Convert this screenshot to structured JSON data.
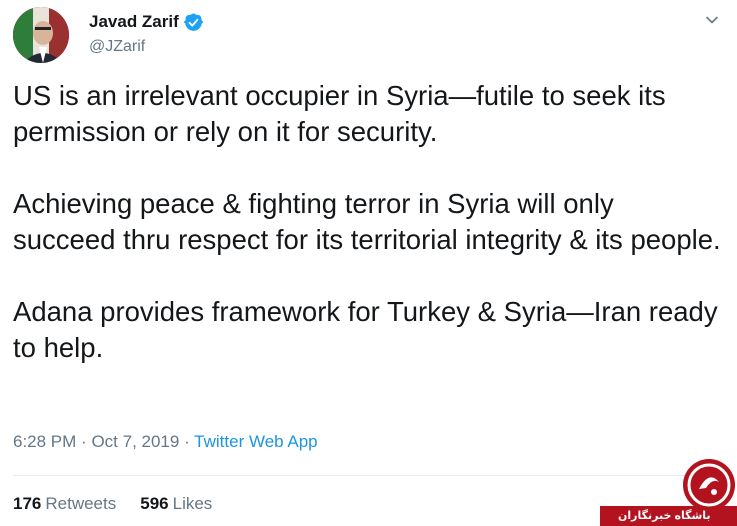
{
  "author": {
    "name": "Javad Zarif",
    "handle": "@JZarif",
    "verified": true
  },
  "tweet": {
    "paragraphs": [
      "US is an irrelevant occupier in Syria—futile to seek its permission or rely on it for security.",
      "Achieving peace & fighting terror in Syria will only succeed thru respect for its territorial integrity & its people.",
      "Adana provides framework for Turkey & Syria—Iran ready to help."
    ],
    "time": "6:28 PM",
    "date": "Oct 7, 2019",
    "separator": "·",
    "source": "Twitter Web App"
  },
  "stats": {
    "retweets_count": "176",
    "retweets_label": "Retweets",
    "likes_count": "596",
    "likes_label": "Likes"
  },
  "watermark": {
    "text": "باشگاه خبرنگاران"
  },
  "colors": {
    "link": "#1b95e0",
    "secondary_text": "#657786",
    "primary_text": "#14171a",
    "verified_badge": "#1da1f2",
    "watermark_red": "#b3121f"
  },
  "icons": {
    "verified": "verified-badge-icon",
    "menu": "chevron-down-icon"
  }
}
